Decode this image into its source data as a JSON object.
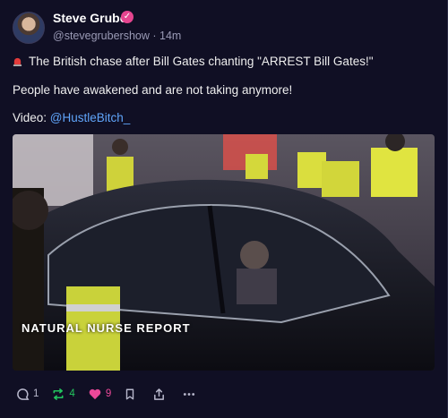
{
  "post": {
    "author_name": "Steve Gruber",
    "handle": "@stevegrubershow",
    "separator": "·",
    "time": "14m",
    "line1": "The British chase after Bill Gates chanting \"ARREST Bill Gates!\"",
    "line2": "People have awakened and are not taking anymore!",
    "video_prefix": "Video: ",
    "video_link": "@HustleBitch_",
    "media_watermark": "NATURAL NURSE REPORT"
  },
  "actions": {
    "replies": "1",
    "reposts": "4",
    "likes": "9"
  },
  "colors": {
    "background": "#100f24",
    "link": "#60a5fa",
    "verified": "#e5458f",
    "repost": "#22c55e",
    "like": "#ec4899"
  },
  "icons": [
    "siren-icon",
    "verified-icon",
    "reply-icon",
    "repost-icon",
    "like-icon",
    "bookmark-icon",
    "share-icon",
    "more-icon"
  ]
}
